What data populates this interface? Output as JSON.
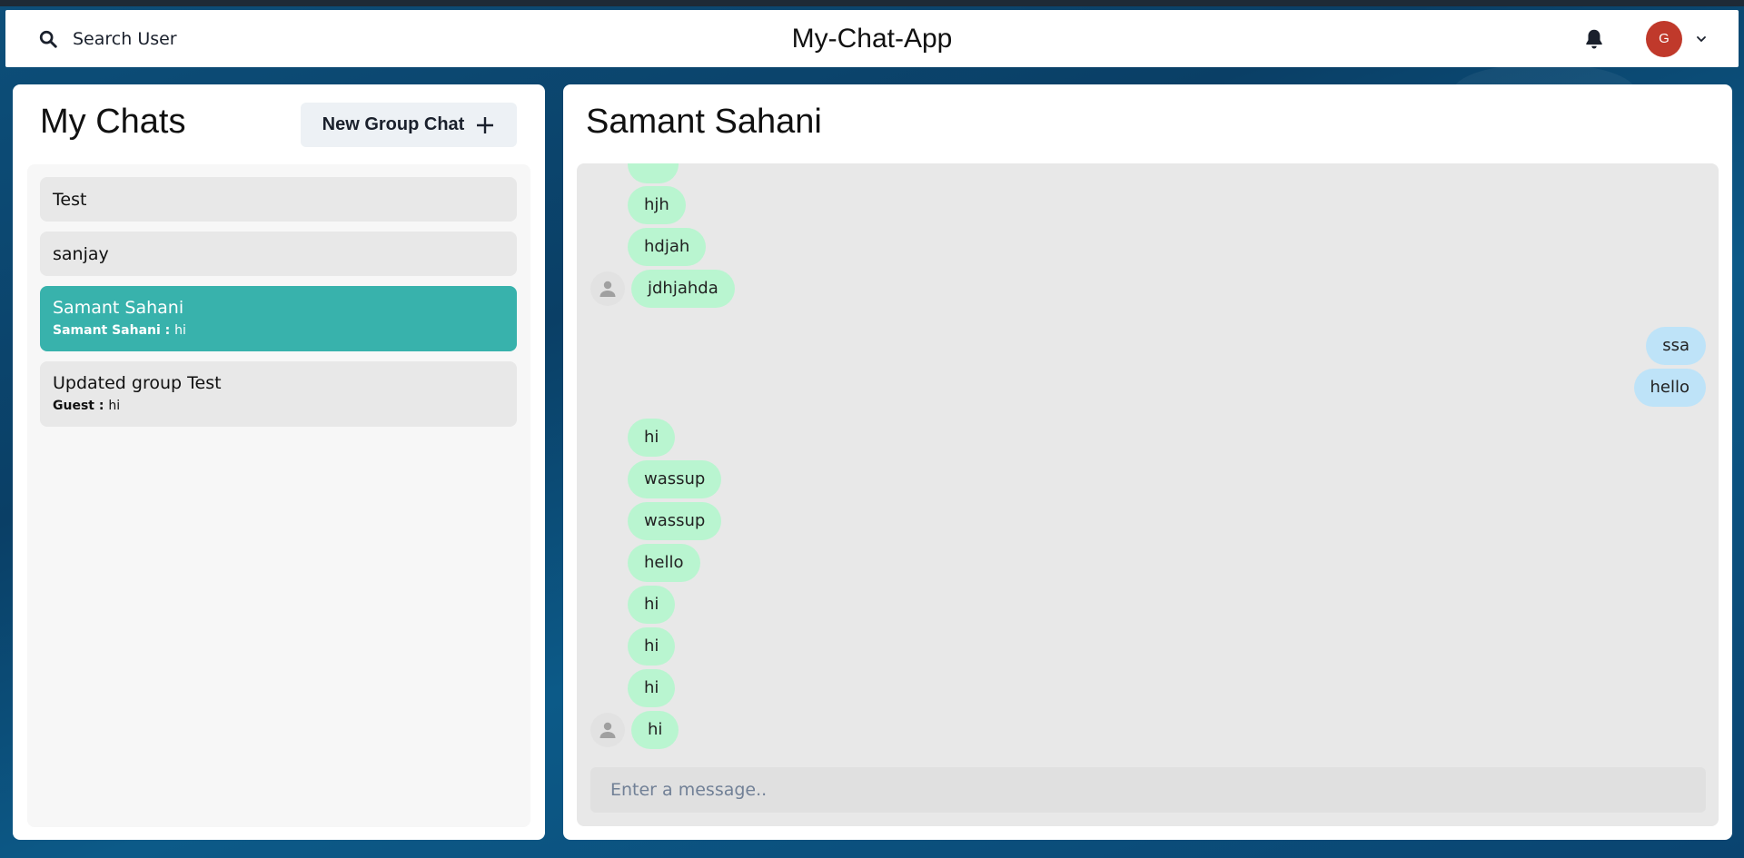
{
  "header": {
    "search_label": "Search User",
    "app_title": "My-Chat-App",
    "avatar_initial": "G",
    "avatar_color": "#c0392b"
  },
  "sidebar": {
    "title": "My Chats",
    "new_group_label": "New Group Chat",
    "chats": [
      {
        "name": "Test",
        "sender": "",
        "preview": "",
        "active": false
      },
      {
        "name": "sanjay",
        "sender": "",
        "preview": "",
        "active": false
      },
      {
        "name": "Samant Sahani",
        "sender": "Samant Sahani : ",
        "preview": "hi",
        "active": true
      },
      {
        "name": "Updated group Test",
        "sender": "Guest : ",
        "preview": "hi",
        "active": false
      }
    ]
  },
  "conversation": {
    "title": "Samant Sahani",
    "messages": [
      {
        "text": "",
        "dir": "in",
        "avatar": false
      },
      {
        "text": "hjh",
        "dir": "in",
        "avatar": false
      },
      {
        "text": "hdjah",
        "dir": "in",
        "avatar": false
      },
      {
        "text": "jdhjahda",
        "dir": "in",
        "avatar": true
      },
      {
        "text": "ssa",
        "dir": "out",
        "avatar": false
      },
      {
        "text": "hello",
        "dir": "out",
        "avatar": false
      },
      {
        "text": "hi",
        "dir": "in",
        "avatar": false
      },
      {
        "text": "wassup",
        "dir": "in",
        "avatar": false
      },
      {
        "text": "wassup",
        "dir": "in",
        "avatar": false
      },
      {
        "text": "hello",
        "dir": "in",
        "avatar": false
      },
      {
        "text": "hi",
        "dir": "in",
        "avatar": false
      },
      {
        "text": "hi",
        "dir": "in",
        "avatar": false
      },
      {
        "text": "hi",
        "dir": "in",
        "avatar": false
      },
      {
        "text": "hi",
        "dir": "in",
        "avatar": true
      }
    ],
    "input_placeholder": "Enter a message.."
  },
  "colors": {
    "active_chat": "#38b2ac",
    "incoming_bubble": "#b9f5d0",
    "outgoing_bubble": "#bee3f8"
  }
}
